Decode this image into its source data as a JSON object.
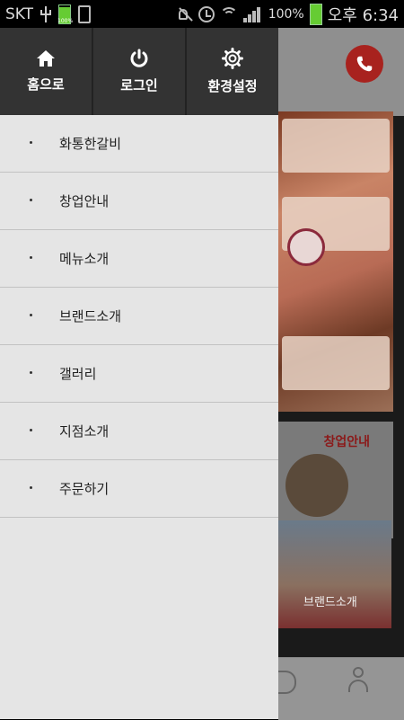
{
  "status_bar": {
    "carrier": "SKT",
    "battery_small_label": "100%",
    "battery_percent": "100%",
    "time": "오후 6:34"
  },
  "drawer": {
    "top_buttons": [
      {
        "label": "홈으로",
        "icon": "home-icon"
      },
      {
        "label": "로그인",
        "icon": "power-icon"
      },
      {
        "label": "환경설정",
        "icon": "gear-icon"
      }
    ],
    "menu_items": [
      {
        "label": "화통한갈비"
      },
      {
        "label": "창업안내"
      },
      {
        "label": "메뉴소개"
      },
      {
        "label": "브랜드소개"
      },
      {
        "label": "갤러리"
      },
      {
        "label": "지점소개"
      },
      {
        "label": "주문하기"
      }
    ]
  },
  "background_app": {
    "franchise_card_label": "창업안내",
    "brand_card_label": "브랜드소개",
    "call_button_icon": "phone-call-icon",
    "bottom_icons": [
      "heart-icon",
      "user-icon"
    ]
  },
  "colors": {
    "drawer_header": "#333333",
    "drawer_bg": "#e5e5e5",
    "accent_red": "#a8221e"
  }
}
